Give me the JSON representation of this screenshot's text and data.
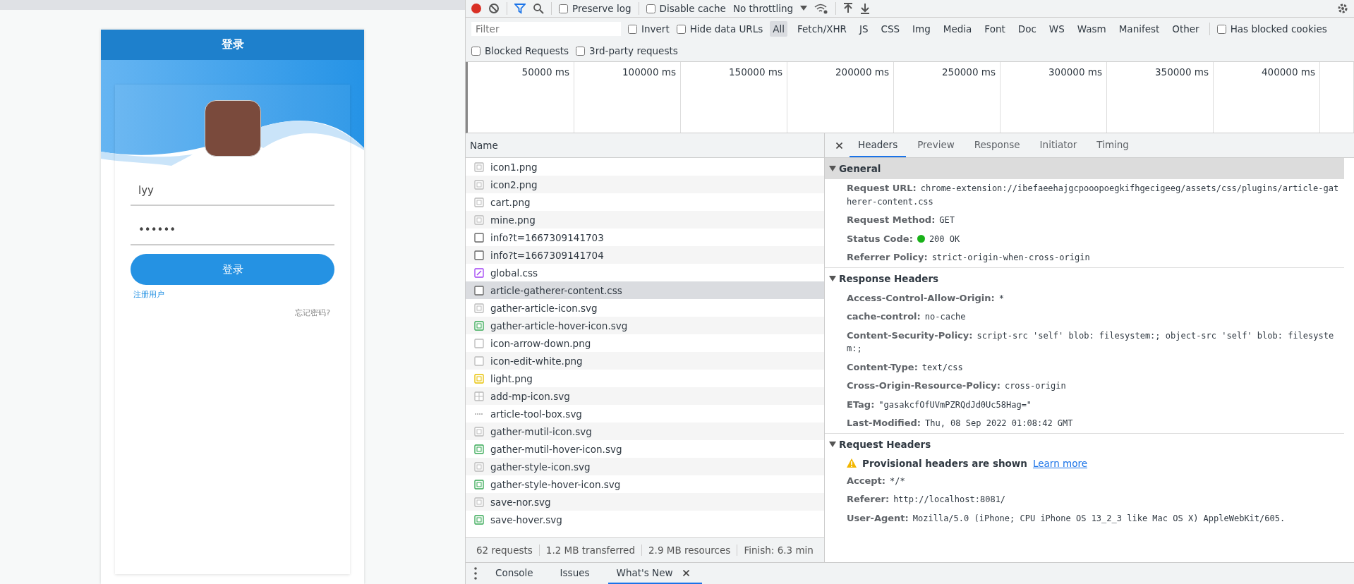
{
  "phone": {
    "title": "登录",
    "username": "lyy",
    "password": "••••••",
    "login_button": "登录",
    "register_link": "注册用户",
    "forgot_link": "忘记密码?"
  },
  "toolbar": {
    "recording": true,
    "preserve_log": {
      "label": "Preserve log",
      "checked": false
    },
    "disable_cache": {
      "label": "Disable cache",
      "checked": false
    },
    "throttling": "No throttling"
  },
  "filter_bar": {
    "placeholder": "Filter",
    "invert": {
      "label": "Invert",
      "checked": false
    },
    "hide_data_urls": {
      "label": "Hide data URLs",
      "checked": false
    },
    "types": [
      {
        "label": "All",
        "selected": true
      },
      {
        "label": "Fetch/XHR",
        "selected": false
      },
      {
        "label": "JS",
        "selected": false
      },
      {
        "label": "CSS",
        "selected": false
      },
      {
        "label": "Img",
        "selected": false
      },
      {
        "label": "Media",
        "selected": false
      },
      {
        "label": "Font",
        "selected": false
      },
      {
        "label": "Doc",
        "selected": false
      },
      {
        "label": "WS",
        "selected": false
      },
      {
        "label": "Wasm",
        "selected": false
      },
      {
        "label": "Manifest",
        "selected": false
      },
      {
        "label": "Other",
        "selected": false
      }
    ],
    "has_blocked_cookies": {
      "label": "Has blocked cookies",
      "checked": false
    },
    "blocked_requests": {
      "label": "Blocked Requests",
      "checked": false
    },
    "third_party": {
      "label": "3rd-party requests",
      "checked": false
    }
  },
  "timeline": {
    "ticks": [
      "50000 ms",
      "100000 ms",
      "150000 ms",
      "200000 ms",
      "250000 ms",
      "300000 ms",
      "350000 ms",
      "400000 ms"
    ]
  },
  "requests": {
    "column": "Name",
    "rows": [
      {
        "name": "icon1.png",
        "kind": "image",
        "selected": false
      },
      {
        "name": "icon2.png",
        "kind": "image",
        "selected": false
      },
      {
        "name": "cart.png",
        "kind": "image",
        "selected": false
      },
      {
        "name": "mine.png",
        "kind": "image",
        "selected": false
      },
      {
        "name": "info?t=1667309141703",
        "kind": "document",
        "selected": false
      },
      {
        "name": "info?t=1667309141704",
        "kind": "document",
        "selected": false
      },
      {
        "name": "global.css",
        "kind": "stylesheet",
        "selected": false
      },
      {
        "name": "article-gatherer-content.css",
        "kind": "document",
        "selected": true
      },
      {
        "name": "gather-article-icon.svg",
        "kind": "image",
        "selected": false
      },
      {
        "name": "gather-article-hover-icon.svg",
        "kind": "image-green",
        "selected": false
      },
      {
        "name": "icon-arrow-down.png",
        "kind": "blank",
        "selected": false
      },
      {
        "name": "icon-edit-white.png",
        "kind": "blank",
        "selected": false
      },
      {
        "name": "light.png",
        "kind": "image-yellow",
        "selected": false
      },
      {
        "name": "add-mp-icon.svg",
        "kind": "grid",
        "selected": false
      },
      {
        "name": "article-tool-box.svg",
        "kind": "dash",
        "selected": false
      },
      {
        "name": "gather-mutil-icon.svg",
        "kind": "image",
        "selected": false
      },
      {
        "name": "gather-mutil-hover-icon.svg",
        "kind": "image-green",
        "selected": false
      },
      {
        "name": "gather-style-icon.svg",
        "kind": "image",
        "selected": false
      },
      {
        "name": "gather-style-hover-icon.svg",
        "kind": "image-green",
        "selected": false
      },
      {
        "name": "save-nor.svg",
        "kind": "image",
        "selected": false
      },
      {
        "name": "save-hover.svg",
        "kind": "image-green",
        "selected": false
      }
    ]
  },
  "summary": [
    "62 requests",
    "1.2 MB transferred",
    "2.9 MB resources",
    "Finish: 6.3 min"
  ],
  "detail_tabs": [
    {
      "label": "Headers",
      "selected": true
    },
    {
      "label": "Preview",
      "selected": false
    },
    {
      "label": "Response",
      "selected": false
    },
    {
      "label": "Initiator",
      "selected": false
    },
    {
      "label": "Timing",
      "selected": false
    }
  ],
  "sections": [
    {
      "title": "General",
      "expanded": true,
      "highlighted": true,
      "rows": [
        {
          "key": "Request URL:",
          "value": "chrome-extension://ibefaeehajgcpooopoegkifhgecigeeg/assets/css/plugins/article-gatherer-content.css"
        },
        {
          "key": "Request Method:",
          "value": "GET"
        },
        {
          "key": "Status Code:",
          "value": "200 OK",
          "color": "#19b219"
        },
        {
          "key": "Referrer Policy:",
          "value": "strict-origin-when-cross-origin"
        }
      ]
    },
    {
      "title": "Response Headers",
      "expanded": true,
      "highlighted": false,
      "rows": [
        {
          "key": "Access-Control-Allow-Origin:",
          "value": "*"
        },
        {
          "key": "cache-control:",
          "value": "no-cache"
        },
        {
          "key": "Content-Security-Policy:",
          "value": "script-src 'self' blob: filesystem:; object-src 'self' blob: filesystem:;"
        },
        {
          "key": "Content-Type:",
          "value": "text/css"
        },
        {
          "key": "Cross-Origin-Resource-Policy:",
          "value": "cross-origin"
        },
        {
          "key": "ETag:",
          "value": "\"gasakcfOfUVmPZRQdJd0Uc58Hag=\""
        },
        {
          "key": "Last-Modified:",
          "value": "Thu, 08 Sep 2022 01:08:42 GMT"
        }
      ]
    },
    {
      "title": "Request Headers",
      "expanded": true,
      "highlighted": false,
      "warning": {
        "text": "Provisional headers are shown",
        "link": "Learn more"
      },
      "rows": [
        {
          "key": "Accept:",
          "value": "*/*"
        },
        {
          "key": "Referer:",
          "value": "http://localhost:8081/"
        },
        {
          "key": "User-Agent:",
          "value": "Mozilla/5.0 (iPhone; CPU iPhone OS 13_2_3 like Mac OS X) AppleWebKit/605."
        }
      ]
    }
  ],
  "drawer_tabs": [
    {
      "label": "Console",
      "selected": false,
      "closable": false
    },
    {
      "label": "Issues",
      "selected": false,
      "closable": false
    },
    {
      "label": "What's New",
      "selected": true,
      "closable": true
    }
  ]
}
